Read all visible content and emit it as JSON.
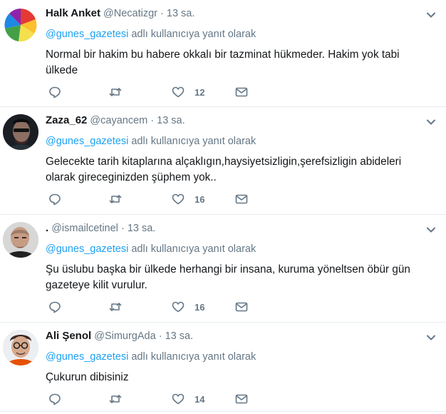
{
  "tweets": [
    {
      "fullname": "Halk Anket",
      "username": "@Necatizgr",
      "dot": "·",
      "time": "13 sa.",
      "reply_mention": "@gunes_gazetesi",
      "reply_suffix": " adlı kullanıcıya yanıt olarak",
      "text": "Normal bir hakim bu habere okkalı bir tazminat hükmeder. Hakim yok tabi ülkede",
      "likes": "12",
      "avatar": "colorful-pie-logo"
    },
    {
      "fullname": "Zaza_62",
      "username": "@cayancem",
      "dot": "·",
      "time": "13 sa.",
      "reply_mention": "@gunes_gazetesi",
      "reply_suffix": " adlı kullanıcıya yanıt olarak",
      "text": "Gelecekte tarih kitaplarına alçaklıgın,haysiyetsizligin,şerefsizligin abideleri olarak gireceginizden şüphem yok..",
      "likes": "16",
      "avatar": "man-with-sunglasses"
    },
    {
      "fullname": ".",
      "username": "@ismailcetinel",
      "dot": "·",
      "time": "13 sa.",
      "reply_mention": "@gunes_gazetesi",
      "reply_suffix": " adlı kullanıcıya yanıt olarak",
      "text": "Şu üslubu başka bir ülkede herhangi bir insana, kuruma yöneltsen öbür gün gazeteye kilit vurulur.",
      "likes": "16",
      "avatar": "bald-man-portrait"
    },
    {
      "fullname": "Ali Şenol",
      "username": "@SimurgAda",
      "dot": "·",
      "time": "13 sa.",
      "reply_mention": "@gunes_gazetesi",
      "reply_suffix": " adlı kullanıcıya yanıt olarak",
      "text": "Çukurun dibisiniz",
      "likes": "14",
      "avatar": "man-with-glasses"
    }
  ],
  "colors": {
    "link": "#1da1f2",
    "secondary": "#657786",
    "divider": "#e6ecf0"
  }
}
